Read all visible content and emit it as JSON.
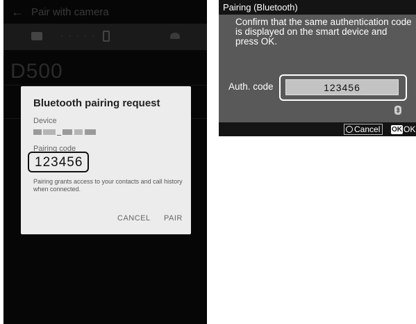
{
  "phone": {
    "appbar": {
      "back_icon": "back-arrow-icon",
      "title": "Pair with camera"
    },
    "status_icons": [
      "camera-icon",
      "dotted-link",
      "smartphone-icon",
      "cloud-icon"
    ],
    "dots": "· · · · ·",
    "camera_name": "D500",
    "dialog": {
      "title": "Bluetooth pairing request",
      "device_label": "Device",
      "device_name_visible": "_",
      "pairing_code_label": "Pairing code",
      "pairing_code": "123456",
      "note": "Pairing grants access to your contacts and call history when connected.",
      "cancel_label": "CANCEL",
      "pair_label": "PAIR"
    }
  },
  "camera_screen": {
    "title": "Pairing (Bluetooth)",
    "message": "Confirm that the same authentication code is displayed on the smart device and press OK.",
    "auth_label": "Auth. code",
    "auth_code": "123456",
    "bt_icon": "bluetooth-icon",
    "footer": {
      "cancel_label": "Cancel",
      "ok_key": "OK",
      "ok_label": "OK"
    }
  },
  "colors": {
    "phone_bg": "#060606",
    "dialog_bg": "#ececec",
    "camera_bg": "#595959",
    "camera_bar": "#141414",
    "auth_field": "#c3c3c3"
  }
}
